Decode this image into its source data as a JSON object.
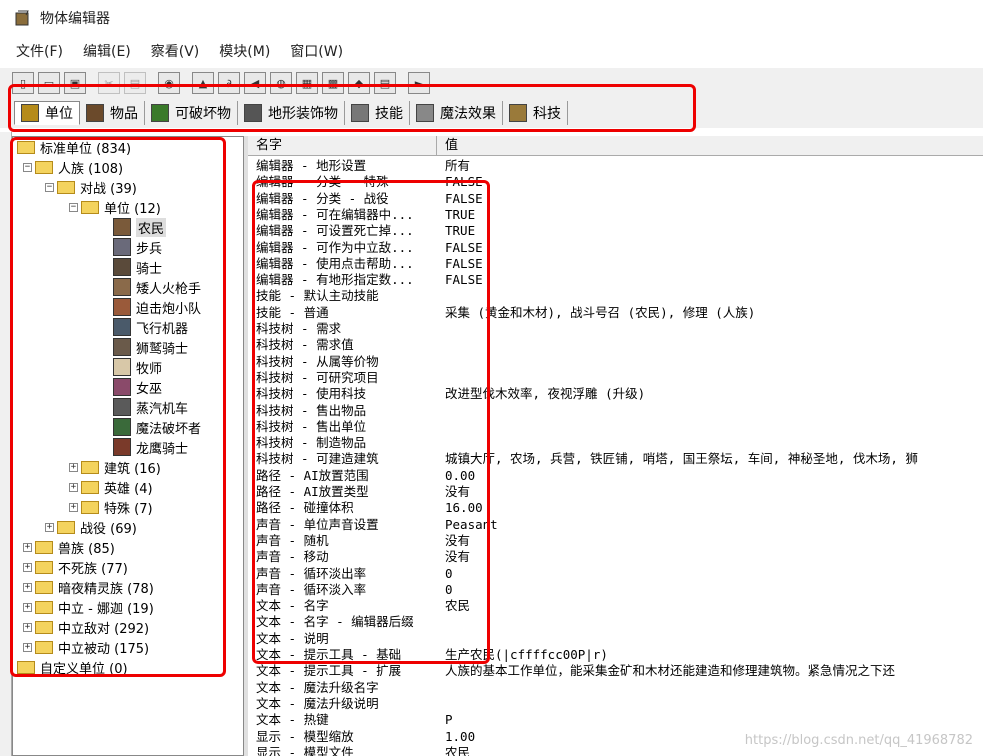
{
  "window": {
    "title": "物体编辑器"
  },
  "menu": [
    "文件(F)",
    "编辑(E)",
    "察看(V)",
    "模块(M)",
    "窗口(W)"
  ],
  "tabs": [
    {
      "label": "单位",
      "icon": "unit-tab-icon",
      "active": true
    },
    {
      "label": "物品",
      "icon": "item-tab-icon",
      "active": false
    },
    {
      "label": "可破坏物",
      "icon": "destructible-tab-icon",
      "active": false
    },
    {
      "label": "地形装饰物",
      "icon": "doodad-tab-icon",
      "active": false
    },
    {
      "label": "技能",
      "icon": "ability-tab-icon",
      "active": false
    },
    {
      "label": "魔法效果",
      "icon": "buff-tab-icon",
      "active": false
    },
    {
      "label": "科技",
      "icon": "upgrade-tab-icon",
      "active": false
    }
  ],
  "tree": {
    "root": "标准单位 (834)",
    "human": "人族 (108)",
    "melee": "对战 (39)",
    "units": "单位 (12)",
    "unit_list": [
      "农民",
      "步兵",
      "骑士",
      "矮人火枪手",
      "迫击炮小队",
      "飞行机器",
      "狮鹫骑士",
      "牧师",
      "女巫",
      "蒸汽机车",
      "魔法破坏者",
      "龙鹰骑士"
    ],
    "buildings": "建筑 (16)",
    "heroes": "英雄 (4)",
    "special": "特殊 (7)",
    "campaign": "战役 (69)",
    "races": [
      "兽族 (85)",
      "不死族 (77)",
      "暗夜精灵族 (78)",
      "中立 - 娜迦 (19)",
      "中立敌对 (292)",
      "中立被动 (175)"
    ],
    "custom": "自定义单位 (0)"
  },
  "grid": {
    "header_name": "名字",
    "header_value": "值",
    "rows": [
      {
        "name": "编辑器 - 地形设置",
        "value": "所有"
      },
      {
        "name": "编辑器 - 分类 - 特殊",
        "value": "FALSE"
      },
      {
        "name": "编辑器 - 分类 - 战役",
        "value": "FALSE"
      },
      {
        "name": "编辑器 - 可在编辑器中...",
        "value": "TRUE"
      },
      {
        "name": "编辑器 - 可设置死亡掉...",
        "value": "TRUE"
      },
      {
        "name": "编辑器 - 可作为中立敌...",
        "value": "FALSE"
      },
      {
        "name": "编辑器 - 使用点击帮助...",
        "value": "FALSE"
      },
      {
        "name": "编辑器 - 有地形指定数...",
        "value": "FALSE"
      },
      {
        "name": "技能 - 默认主动技能",
        "value": ""
      },
      {
        "name": "技能 - 普通",
        "value": "采集 (黄金和木材), 战斗号召 (农民), 修理 (人族)"
      },
      {
        "name": "科技树 - 需求",
        "value": ""
      },
      {
        "name": "科技树 - 需求值",
        "value": ""
      },
      {
        "name": "科技树 - 从属等价物",
        "value": ""
      },
      {
        "name": "科技树 - 可研究项目",
        "value": ""
      },
      {
        "name": "科技树 - 使用科技",
        "value": "改进型伐木效率, 夜视浮雕 (升级)"
      },
      {
        "name": "科技树 - 售出物品",
        "value": ""
      },
      {
        "name": "科技树 - 售出单位",
        "value": ""
      },
      {
        "name": "科技树 - 制造物品",
        "value": ""
      },
      {
        "name": "科技树 - 可建造建筑",
        "value": "城镇大厅, 农场, 兵营, 铁匠铺, 哨塔, 国王祭坛, 车间, 神秘圣地, 伐木场, 狮"
      },
      {
        "name": "路径 - AI放置范围",
        "value": "0.00"
      },
      {
        "name": "路径 - AI放置类型",
        "value": "没有"
      },
      {
        "name": "路径 - 碰撞体积",
        "value": "16.00"
      },
      {
        "name": "声音 - 单位声音设置",
        "value": "Peasant"
      },
      {
        "name": "声音 - 随机",
        "value": "没有"
      },
      {
        "name": "声音 - 移动",
        "value": "没有"
      },
      {
        "name": "声音 - 循环淡出率",
        "value": "0"
      },
      {
        "name": "声音 - 循环淡入率",
        "value": "0"
      },
      {
        "name": "文本 - 名字",
        "value": "农民"
      },
      {
        "name": "文本 - 名字 - 编辑器后缀",
        "value": ""
      },
      {
        "name": "文本 - 说明",
        "value": ""
      },
      {
        "name": "文本 - 提示工具 - 基础",
        "value": "生产农民(|cffffcc00P|r)"
      },
      {
        "name": "文本 - 提示工具 - 扩展",
        "value": "人族的基本工作单位，能采集金矿和木材还能建造和修理建筑物。紧急情况之下还"
      },
      {
        "name": "文本 - 魔法升级名字",
        "value": ""
      },
      {
        "name": "文本 - 魔法升级说明",
        "value": ""
      },
      {
        "name": "文本 - 热键",
        "value": "P"
      },
      {
        "name": "显示 - 模型缩放",
        "value": "1.00"
      },
      {
        "name": "显示 - 模型文件",
        "value": "农民"
      }
    ]
  },
  "watermark": "https://blog.csdn.net/qq_41968782",
  "colors": {
    "highlight_box": "#e00000",
    "folder": "#f4d35e"
  }
}
